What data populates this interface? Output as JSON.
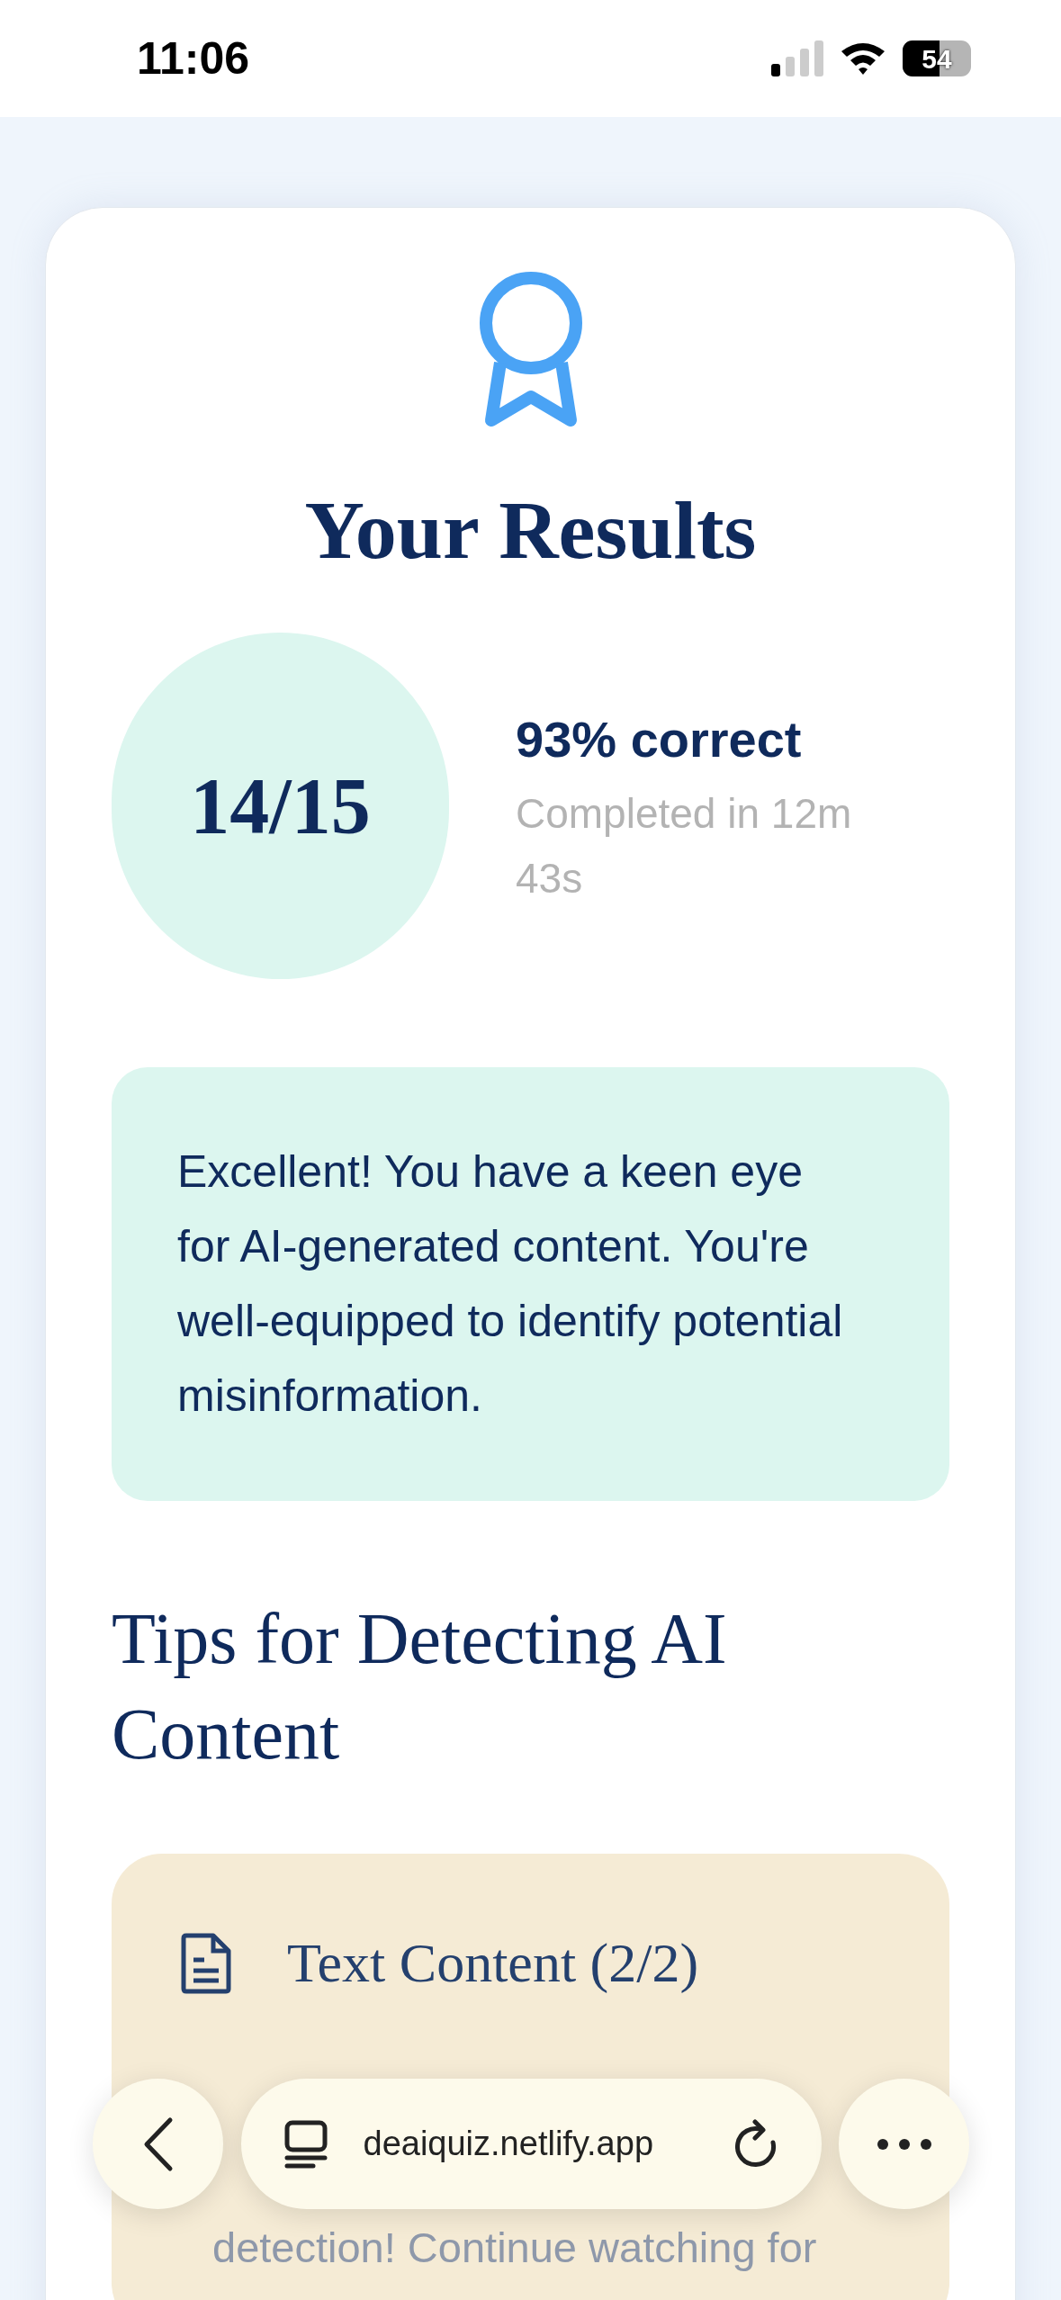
{
  "status_bar": {
    "time": "11:06",
    "battery": "54"
  },
  "results": {
    "title": "Your Results",
    "score": "14/15",
    "percent": "93% correct",
    "duration": "Completed in 12m 43s",
    "message": "Excellent! You have a keen eye for AI-generated content. You're well-equipped to identify potential misinformation."
  },
  "tips": {
    "heading": "Tips for Detecting AI Content",
    "cards": [
      {
        "title": "Text Content (2/2)",
        "text": "detection! Continue watching for"
      }
    ]
  },
  "browser_bar": {
    "url": "deaiquiz.netlify.app"
  }
}
